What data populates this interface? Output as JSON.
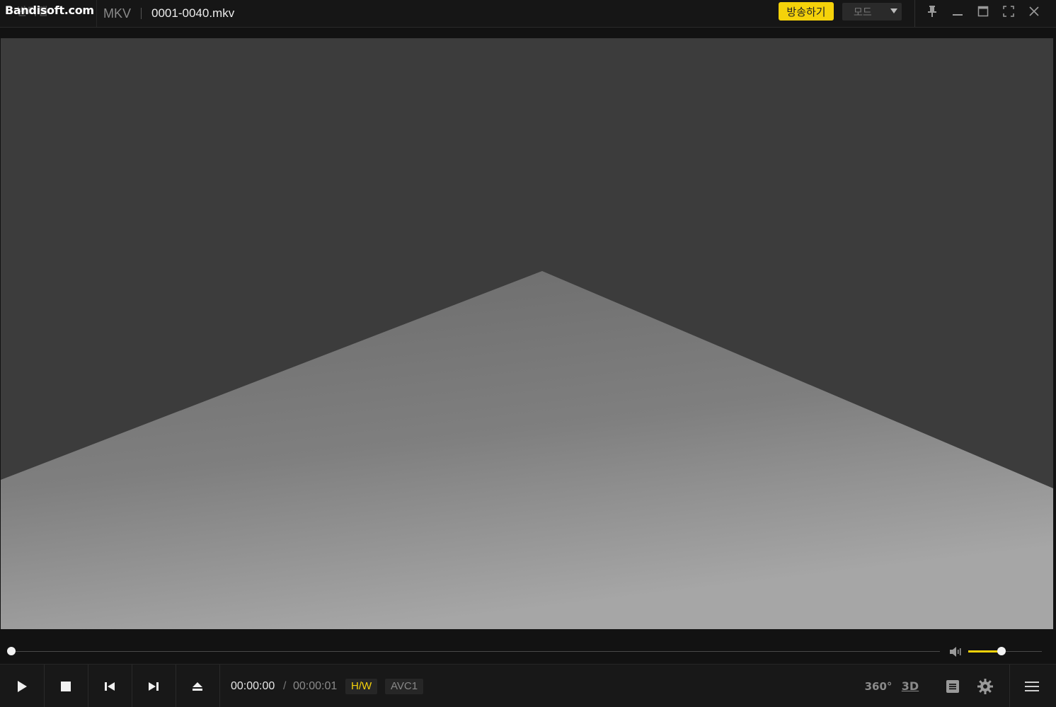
{
  "titlebar": {
    "logo": "Bandisoft.com",
    "logo_shadow": "반디캠",
    "format": "MKV",
    "filename": "0001-0040.mkv",
    "broadcast_label": "방송하기",
    "mode_label": "모드"
  },
  "controls": {
    "time_current": "00:00:00",
    "time_separator": "/",
    "time_total": "00:00:01",
    "hw_badge": "H/W",
    "codec_badge": "AVC1",
    "label_360": "360°",
    "label_3d": "3D"
  },
  "playback": {
    "seek_progress": 0.0,
    "volume_level": 0.45
  },
  "colors": {
    "accent": "#f5d20a",
    "background": "#121212",
    "video_bg": "#3b3b3b"
  },
  "icons": {
    "pin": "pin-icon",
    "minimize": "minimize-icon",
    "maximize": "maximize-icon",
    "fullscreen": "fullscreen-icon",
    "close": "close-icon",
    "play": "play-icon",
    "stop": "stop-icon",
    "prev": "previous-icon",
    "next": "next-icon",
    "eject": "eject-icon",
    "volume": "volume-icon",
    "playlist": "playlist-icon",
    "settings": "gear-icon",
    "menu": "hamburger-menu-icon"
  }
}
